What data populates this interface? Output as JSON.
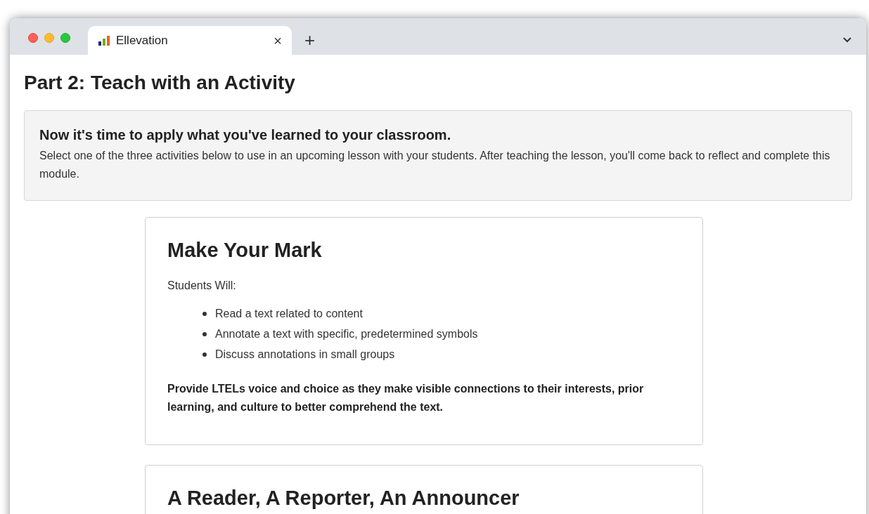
{
  "tabs": [
    {
      "label": "Ellevation",
      "selected": true
    }
  ],
  "new_tab": "+",
  "close": "×",
  "page_title": "Part 2: Teach with an Activity",
  "banner": {
    "heading": "Now it's time to apply what you've learned to your classroom.",
    "text": "Select one of the three activities below to use in an upcoming lesson with your students. After teaching the lesson, you'll come back to reflect and complete this module."
  },
  "activities": [
    {
      "title": "Make Your Mark",
      "intro": "Students Will:",
      "items": [
        "Read a text related to content",
        "Annotate a text with specific, predetermined symbols",
        "Discuss annotations in small groups"
      ],
      "summary": "Provide LTELs voice and choice as they make visible connections to their interests, prior learning, and culture to better comprehend the text."
    },
    {
      "title": "A Reader, A Reporter, An Announcer"
    }
  ]
}
